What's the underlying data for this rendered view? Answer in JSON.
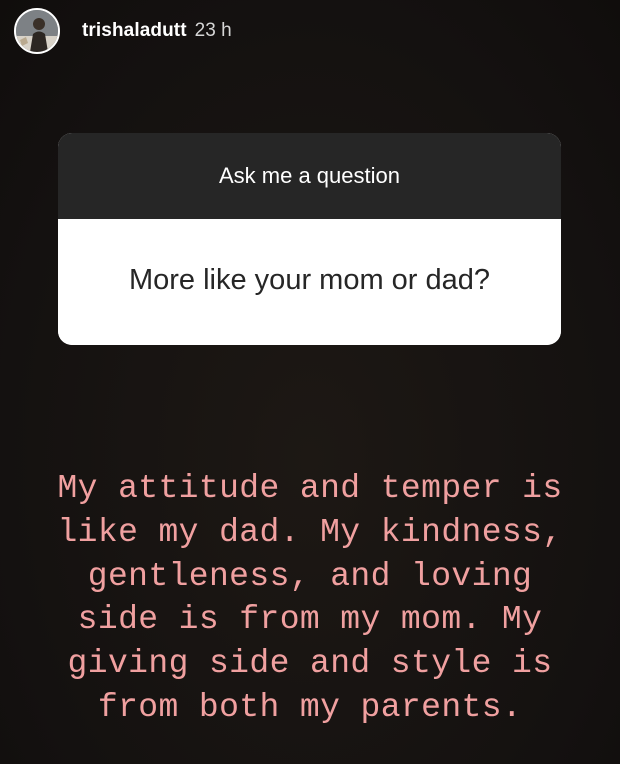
{
  "header": {
    "username": "trishaladutt",
    "time": "23 h",
    "avatar_icon": "profile-photo-icon"
  },
  "question_sticker": {
    "prompt": "Ask me a question",
    "question": "More like your mom or dad?"
  },
  "answer": {
    "lines": [
      "My attitude and temper is",
      "like my dad. My kindness,",
      "gentleness, and loving",
      "side is from my mom. My",
      "giving side and style is",
      "from both my parents."
    ],
    "color": "#f0a0a0"
  },
  "colors": {
    "background": "#16120f",
    "sticker_header": "#262626",
    "sticker_body": "#ffffff"
  }
}
